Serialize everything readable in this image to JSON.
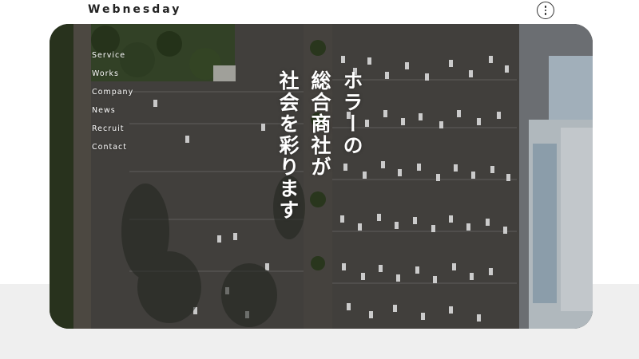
{
  "header": {
    "logo": "Webnesday",
    "menu_button_icon": "more-vertical-icon"
  },
  "nav": {
    "items": [
      "Service",
      "Works",
      "Company",
      "News",
      "Recruit",
      "Contact"
    ]
  },
  "hero": {
    "tagline_lines": [
      "ホラーの",
      "総合商社が",
      "社会を彩ります"
    ]
  },
  "colors": {
    "text_dark": "#222222",
    "hero_text": "#ffffff",
    "band": "#efefef"
  }
}
